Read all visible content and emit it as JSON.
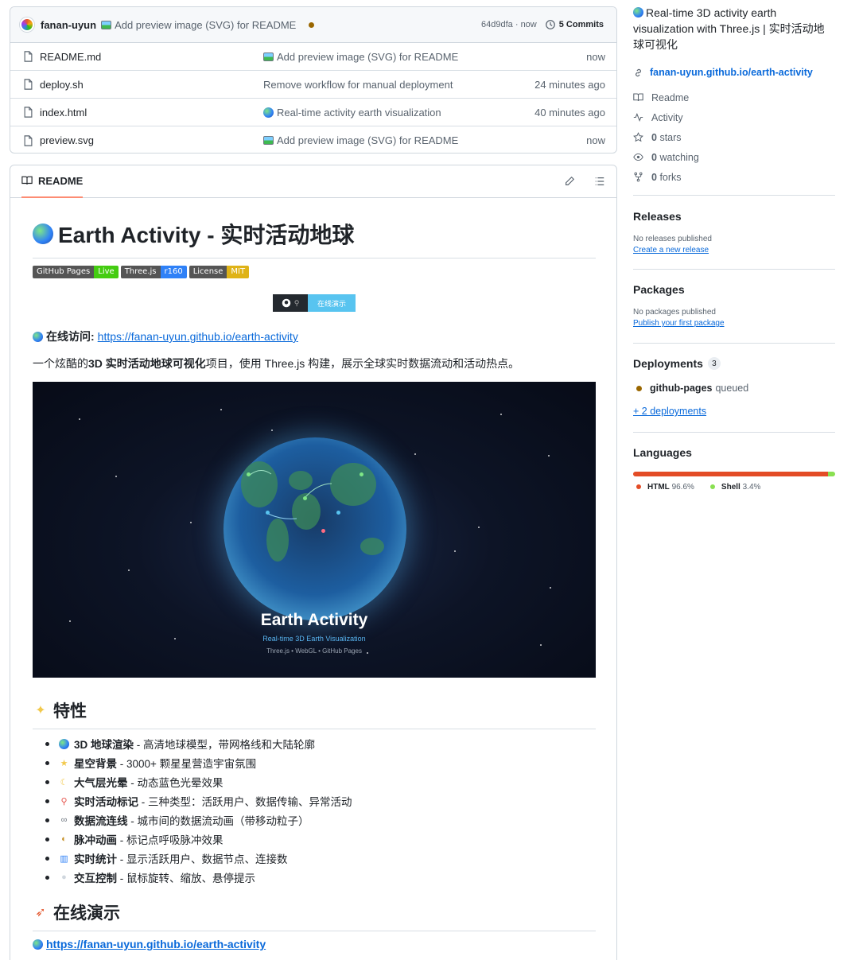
{
  "commit": {
    "author": "fanan-uyun",
    "message": "Add preview image (SVG) for README",
    "hash_time": "64d9dfa · now",
    "commits": "5 Commits"
  },
  "files": [
    {
      "name": "README.md",
      "message": "Add preview image (SVG) for README",
      "icon": "image-emoji",
      "time": "now"
    },
    {
      "name": "deploy.sh",
      "message": "Remove workflow for manual deployment",
      "icon": "",
      "time": "24 minutes ago"
    },
    {
      "name": "index.html",
      "message": "Real-time activity earth visualization",
      "icon": "globe-emoji",
      "time": "40 minutes ago"
    },
    {
      "name": "preview.svg",
      "message": "Add preview image (SVG) for README",
      "icon": "image-emoji",
      "time": "now"
    }
  ],
  "readme": {
    "tab": "README",
    "title": "Earth Activity - 实时活动地球",
    "badges": [
      {
        "left": "GitHub Pages",
        "right": "Live",
        "color": "#4c1"
      },
      {
        "left": "Three.js",
        "right": "r160",
        "color": "#2f81f7"
      },
      {
        "left": "License",
        "right": "MIT",
        "color": "#dfb317"
      }
    ],
    "demo_badge": "在线演示",
    "visit_label": "在线访问:",
    "visit_url": "https://fanan-uyun.github.io/earth-activity",
    "intro_pre": "一个炫酷的 ",
    "intro_bold": "3D 实时活动地球可视化",
    "intro_post": "项目，使用 Three.js 构建，展示全球实时数据流动和活动热点。",
    "preview": {
      "title": "Earth Activity",
      "subtitle": "Real-time 3D Earth Visualization",
      "tech": "Three.js • WebGL • GitHub Pages"
    },
    "features_heading": "特性",
    "features": [
      {
        "icon": "globe",
        "bold": "3D 地球渲染",
        "text": " - 高清地球模型，带网格线和大陆轮廓"
      },
      {
        "icon": "star",
        "bold": "星空背景",
        "text": " - 3000+ 颗星星营造宇宙氛围"
      },
      {
        "icon": "halo",
        "bold": "大气层光晕",
        "text": " - 动态蓝色光晕效果"
      },
      {
        "icon": "pin",
        "bold": "实时活动标记",
        "text": " - 三种类型：活跃用户、数据传输、异常活动"
      },
      {
        "icon": "link",
        "bold": "数据流连线",
        "text": " - 城市间的数据流动画（带移动粒子）"
      },
      {
        "icon": "palette",
        "bold": "脉冲动画",
        "text": " - 标记点呼吸脉冲效果"
      },
      {
        "icon": "chart",
        "bold": "实时统计",
        "text": " - 显示活跃用户、数据节点、连接数"
      },
      {
        "icon": "pointer",
        "bold": "交互控制",
        "text": " - 鼠标旋转、缩放、悬停提示"
      }
    ],
    "demo_heading": "在线演示",
    "demo_url": "https://fanan-uyun.github.io/earth-activity"
  },
  "sidebar": {
    "about": "Real-time 3D activity earth visualization with Three.js | 实时活动地球可视化",
    "homepage": "fanan-uyun.github.io/earth-activity",
    "readme": "Readme",
    "activity": "Activity",
    "stars_n": "0",
    "stars": "stars",
    "watching_n": "0",
    "watching": "watching",
    "forks_n": "0",
    "forks": "forks",
    "releases_h": "Releases",
    "releases_none": "No releases published",
    "releases_link": "Create a new release",
    "packages_h": "Packages",
    "packages_none": "No packages published",
    "packages_link": "Publish your first package",
    "deployments_h": "Deployments",
    "deployments_count": "3",
    "deploy_env": "github-pages",
    "deploy_state": "queued",
    "deploy_more": "+ 2 deployments",
    "languages_h": "Languages",
    "languages": [
      {
        "name": "HTML",
        "pct": "96.6%",
        "value": 96.6,
        "color": "#e34c26"
      },
      {
        "name": "Shell",
        "pct": "3.4%",
        "value": 3.4,
        "color": "#89e051"
      }
    ]
  }
}
